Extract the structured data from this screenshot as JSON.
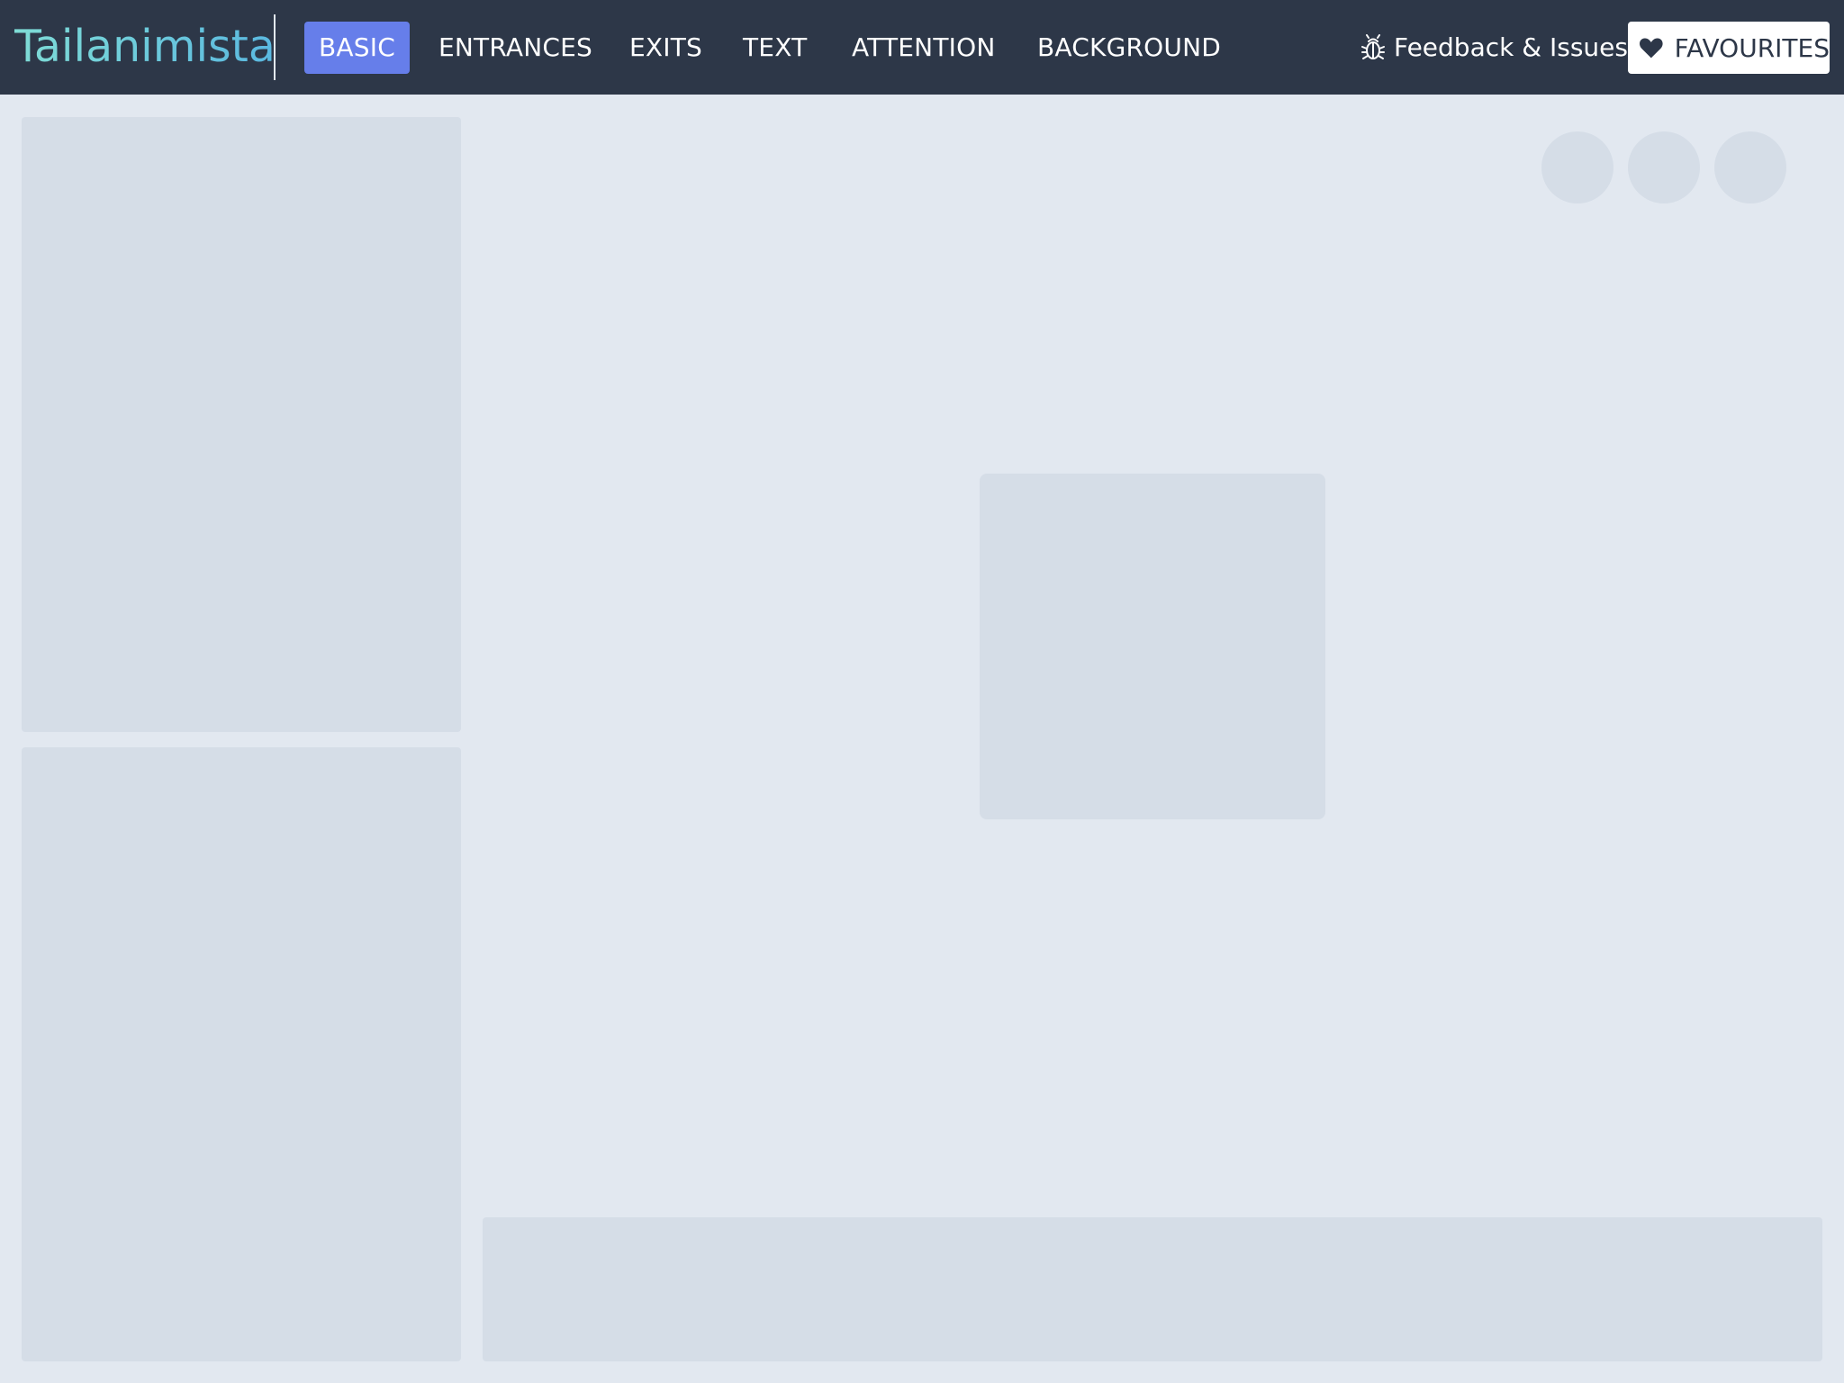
{
  "brand": {
    "name": "Tailanimista"
  },
  "nav": {
    "items": [
      {
        "label": "BASIC",
        "active": true
      },
      {
        "label": "ENTRANCES",
        "active": false
      },
      {
        "label": "EXITS",
        "active": false
      },
      {
        "label": "TEXT",
        "active": false
      },
      {
        "label": "ATTENTION",
        "active": false
      },
      {
        "label": "BACKGROUND",
        "active": false
      }
    ],
    "feedback": {
      "label": "Feedback & Issues",
      "icon": "bug-icon"
    },
    "favourites": {
      "label": "FAVOURITES",
      "icon": "heart-icon"
    }
  },
  "colors": {
    "navbar_bg": "#2d3748",
    "active_tab": "#667eea",
    "page_bg": "#e2e8f0",
    "skeleton": "#d5dde7"
  },
  "content": {
    "state": "loading-skeleton",
    "toolbar_buttons": 3
  }
}
